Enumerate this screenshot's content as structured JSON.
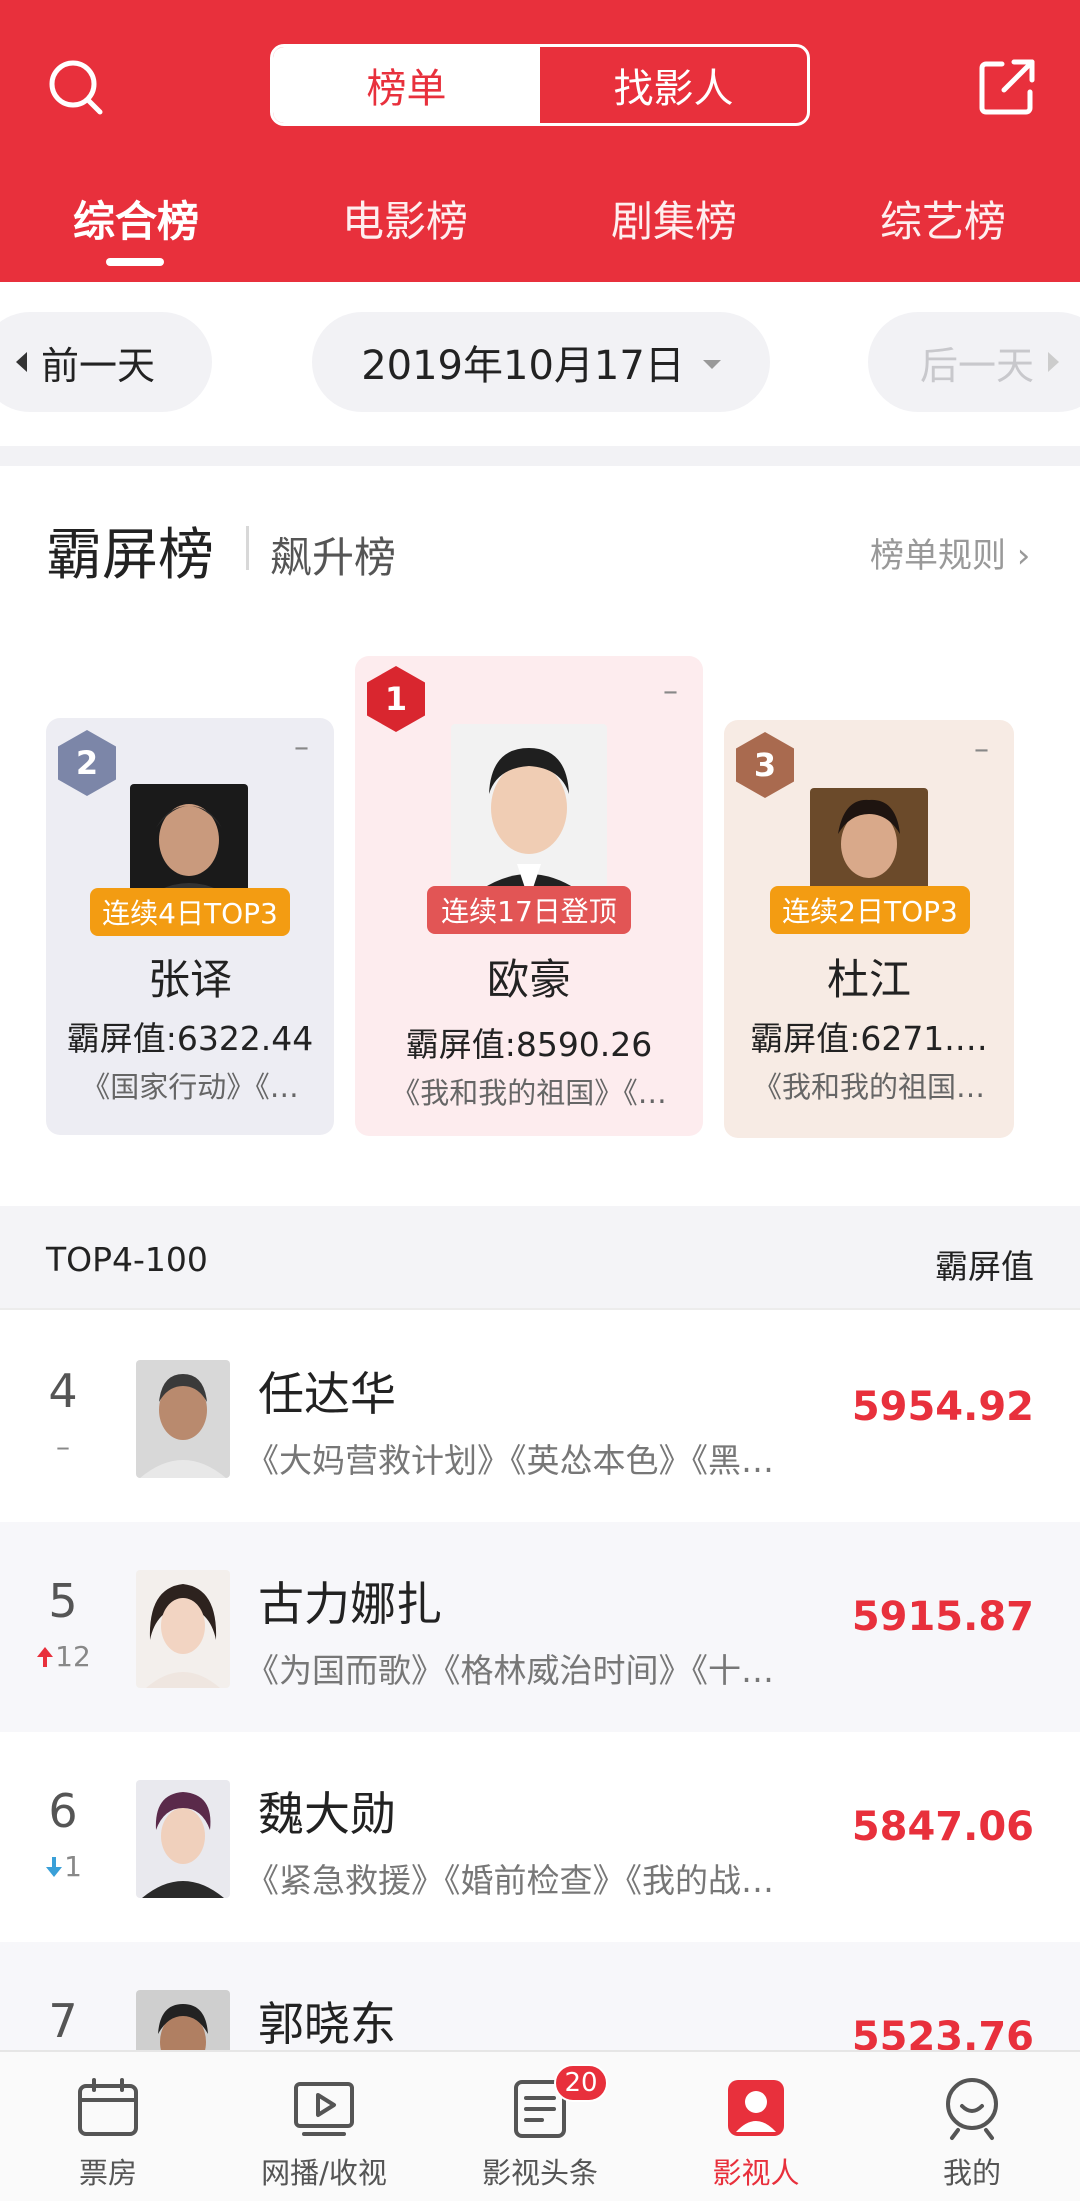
{
  "header": {
    "segments": [
      "榜单",
      "找影人"
    ],
    "tabs": [
      "综合榜",
      "电影榜",
      "剧集榜",
      "综艺榜"
    ]
  },
  "datebar": {
    "prev": "前一天",
    "date": "2019年10月17日",
    "next": "后一天"
  },
  "section": {
    "title": "霸屏榜",
    "subtitle": "飙升榜",
    "rules": "榜单规则 ›"
  },
  "podium": [
    {
      "rank": "2",
      "name": "张译",
      "streak": "连续4日TOP3",
      "score": "霸屏值:6322.44",
      "works": "《国家行动》《…",
      "change": "–"
    },
    {
      "rank": "1",
      "name": "欧豪",
      "streak": "连续17日登顶",
      "score": "霸屏值:8590.26",
      "works": "《我和我的祖国》《…",
      "change": "–"
    },
    {
      "rank": "3",
      "name": "杜江",
      "streak": "连续2日TOP3",
      "score": "霸屏值:6271.…",
      "works": "《我和我的祖国…",
      "change": "–"
    }
  ],
  "list_header": {
    "left": "TOP4-100",
    "right": "霸屏值"
  },
  "rows": [
    {
      "rank": "4",
      "change": "–",
      "name": "任达华",
      "works": "《大妈营救计划》《英怂本色》《黑…",
      "score": "5954.92"
    },
    {
      "rank": "5",
      "change": "12",
      "name": "古力娜扎",
      "works": "《为国而歌》《格林威治时间》《十…",
      "score": "5915.87"
    },
    {
      "rank": "6",
      "change": "1",
      "name": "魏大勋",
      "works": "《紧急救援》《婚前检查》《我的战…",
      "score": "5847.06"
    },
    {
      "rank": "7",
      "change": "",
      "name": "郭晓东",
      "works": "",
      "score": "5523.76"
    }
  ],
  "nav": [
    {
      "label": "票房"
    },
    {
      "label": "网播/收视"
    },
    {
      "label": "影视头条",
      "badge": "20"
    },
    {
      "label": "影视人"
    },
    {
      "label": "我的"
    }
  ],
  "colors": {
    "accent": "#e8303c",
    "silver": "#7c86a8",
    "bronze": "#a96a4f",
    "streak_orange": "#f39c12",
    "streak_red": "#e25555"
  }
}
